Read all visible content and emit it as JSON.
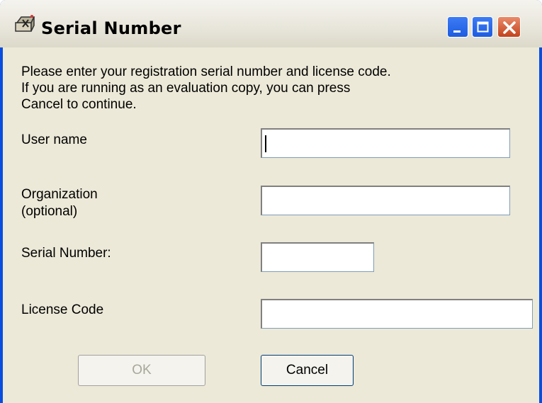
{
  "window": {
    "title": "Serial Number"
  },
  "intro": {
    "line1": "Please enter your registration serial number and license code.",
    "line2": "If you are running as an evaluation copy, you can press",
    "line3": "Cancel to continue."
  },
  "fields": {
    "user_name": {
      "label": "User name",
      "value": ""
    },
    "organization": {
      "label_line1": "Organization",
      "label_line2": "(optional)",
      "value": ""
    },
    "serial_number": {
      "label": "Serial Number:",
      "value": ""
    },
    "license_code": {
      "label": "License Code",
      "value": ""
    }
  },
  "buttons": {
    "ok": "OK",
    "cancel": "Cancel"
  },
  "colors": {
    "titlebar_frame": "#0a4ee0",
    "client_bg": "#ece9d8",
    "close_button": "#c3421c"
  }
}
